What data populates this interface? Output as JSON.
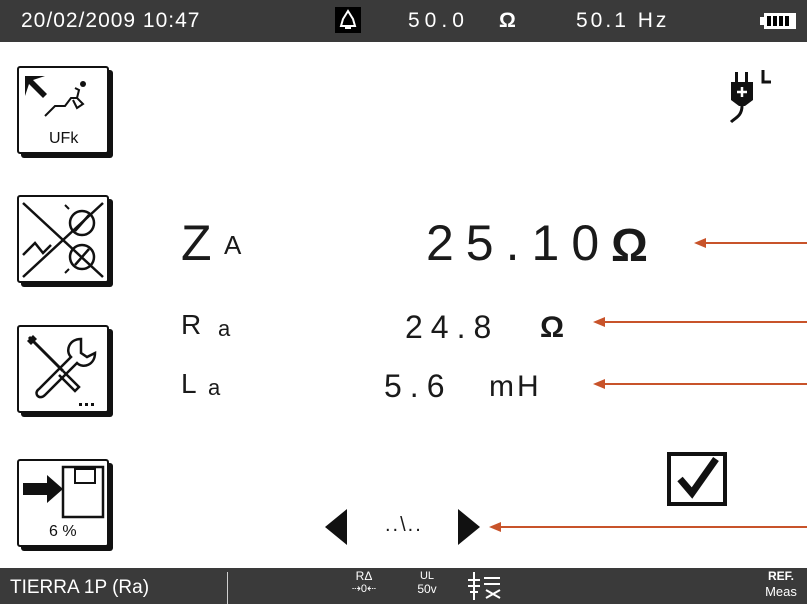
{
  "status_bar": {
    "date_time": "20/02/2009 10:47",
    "impedance": "50.0",
    "impedance_unit": "Ω",
    "frequency": "50.1 Hz"
  },
  "side_buttons": {
    "ufk_label": "UFk",
    "memory_percent": "6 %"
  },
  "measurements": {
    "za_label": "Z",
    "za_sub": "A",
    "za_value": "25.10",
    "za_unit": "Ω",
    "ra_label": "R",
    "ra_sub": "a",
    "ra_value": "24.8",
    "ra_unit": "Ω",
    "la_label": "L",
    "la_sub": "a",
    "la_value": "5.6",
    "la_unit": "mH"
  },
  "navigation": {
    "page_indicator": "..\\.."
  },
  "bottom_bar": {
    "mode": "TIERRA 1P (Ra)",
    "icon1_top": "RΔ",
    "icon1_bottom": "⇢0⇠",
    "icon2_top": "UL",
    "icon2_bottom": "50v",
    "ref_top": "REF.",
    "ref_bottom": "Meas"
  },
  "colors": {
    "bar_bg": "#3a3a3a",
    "pointer": "#c8532a",
    "text": "#1a1a1a"
  }
}
